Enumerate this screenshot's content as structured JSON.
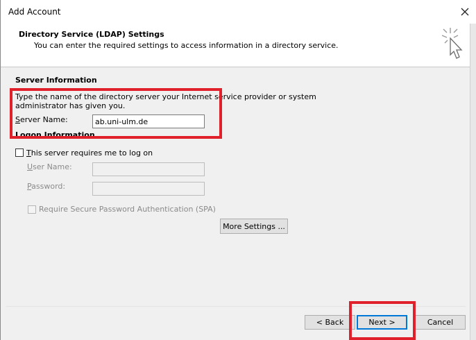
{
  "window": {
    "title": "Add Account",
    "close_icon": "close-icon"
  },
  "header": {
    "title": "Directory Service (LDAP) Settings",
    "subtitle": "You can enter the required settings to access information in a directory service.",
    "icon": "cursor-sparkle-icon"
  },
  "server_info": {
    "section_title": "Server Information",
    "instructions_line1": "Type the name of the directory server your Internet service provider or system",
    "instructions_line2": "administrator has given you.",
    "server_name_label": "Server Name:",
    "server_name_value": "ab.uni-ulm.de"
  },
  "logon_info": {
    "section_title": "Logon Information",
    "requires_logon_label": "This server requires me to log on",
    "requires_logon_checked": false,
    "user_name_label": "User Name:",
    "user_name_value": "",
    "password_label": "Password:",
    "password_value": "",
    "spa_label": "Require Secure Password Authentication (SPA)",
    "spa_checked": false
  },
  "buttons": {
    "more_settings": "More Settings ...",
    "back": "< Back",
    "next": "Next >",
    "cancel": "Cancel"
  },
  "colors": {
    "highlight": "#e0202a",
    "default_button_border": "#0078d7"
  }
}
